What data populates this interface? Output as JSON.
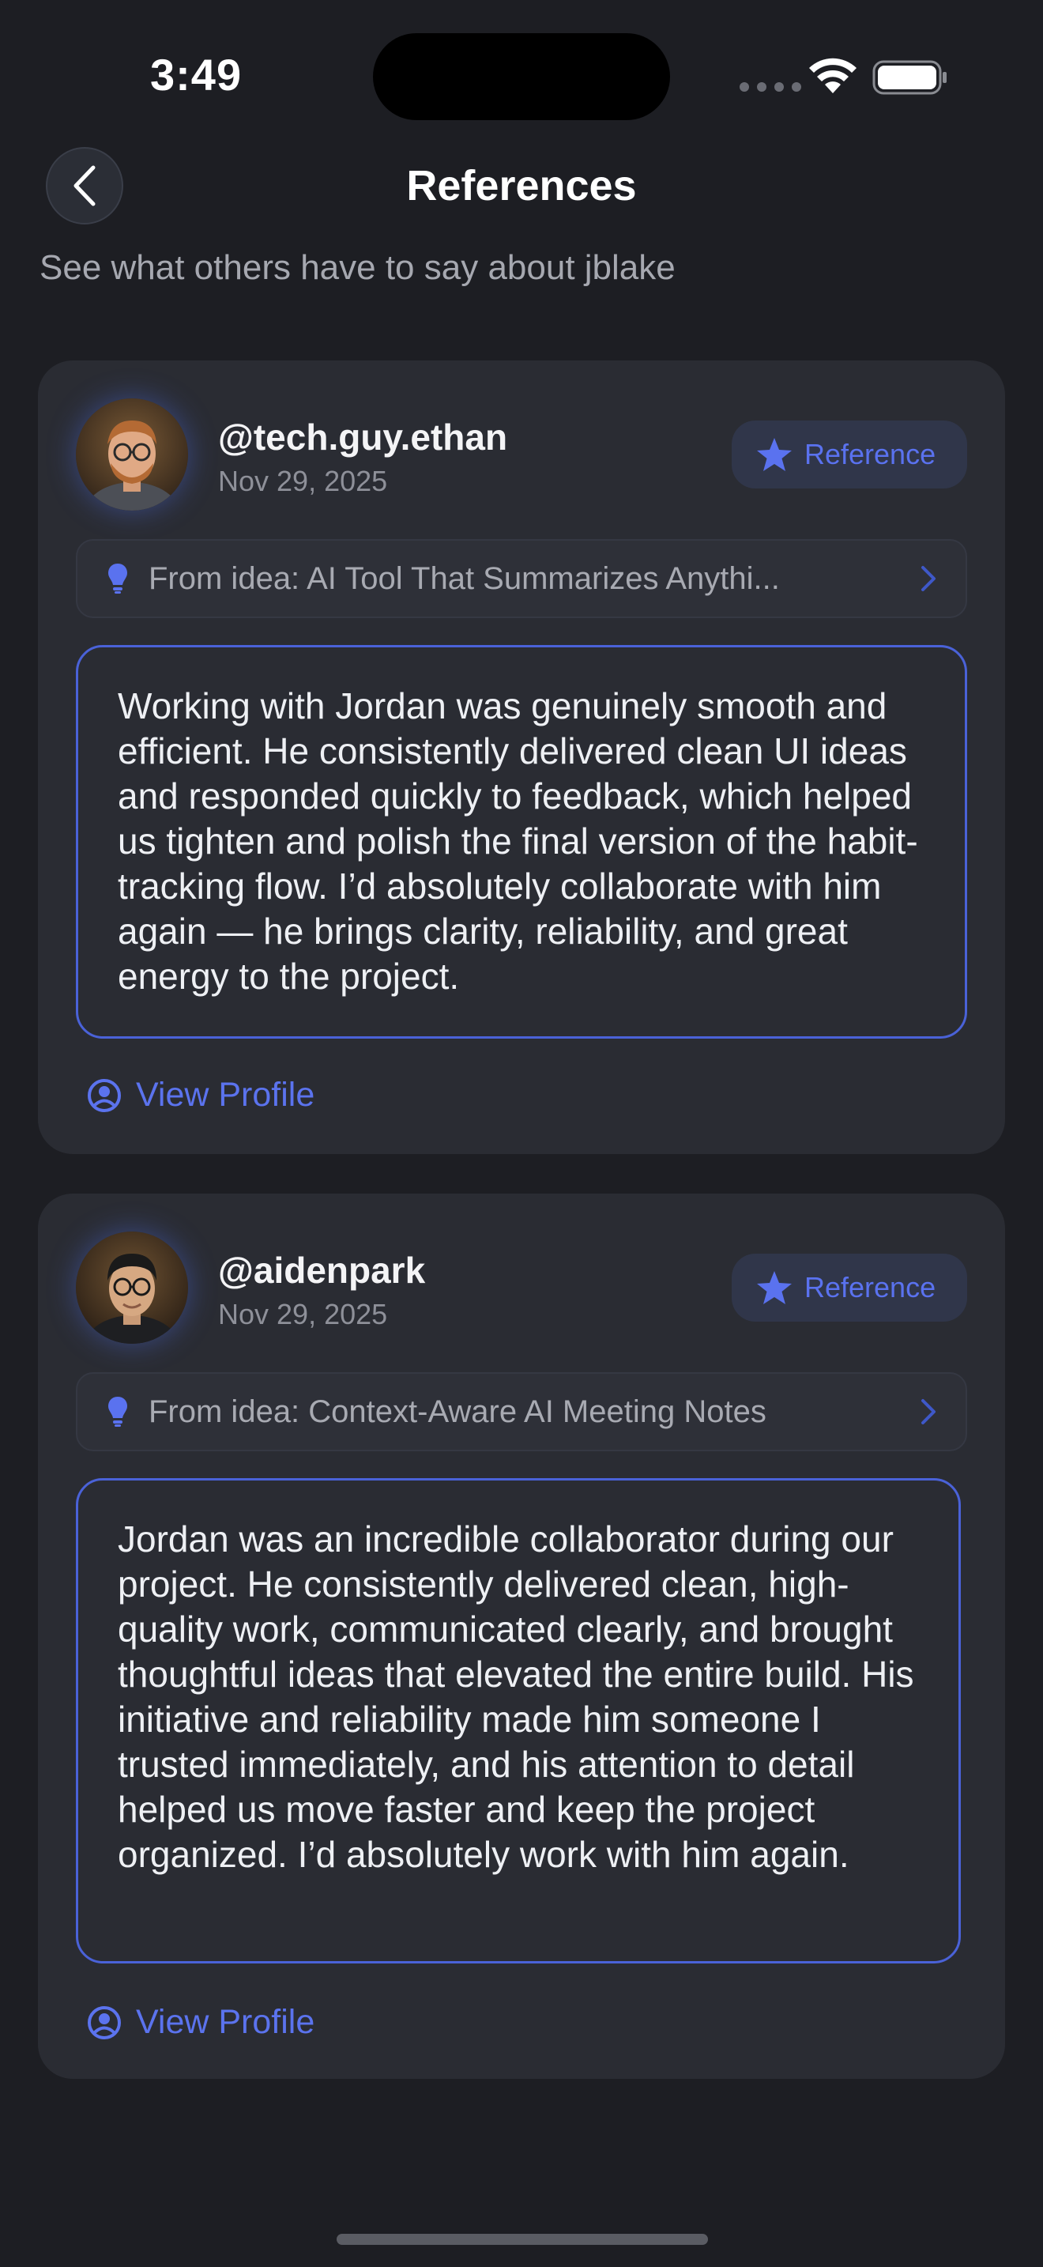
{
  "status_bar": {
    "time": "3:49"
  },
  "nav": {
    "title": "References",
    "subtitle": "See what others have to say about jblake"
  },
  "references": [
    {
      "username": "@tech.guy.ethan",
      "date": "Nov 29, 2025",
      "badge_label": "Reference",
      "idea_label": "From idea: AI Tool That Summarizes Anythi...",
      "text": "Working with Jordan was genuinely smooth and efficient. He consistently delivered clean UI ideas and responded quickly to feedback, which helped us tighten and polish the final version of the habit-tracking flow. I’d absolutely collaborate with him again — he brings clarity, reliability, and great energy to the project.",
      "view_profile_label": "View Profile"
    },
    {
      "username": "@aidenpark",
      "date": "Nov 29, 2025",
      "badge_label": "Reference",
      "idea_label": "From idea: Context-Aware AI Meeting Notes",
      "text": "Jordan was an incredible collaborator during our project. He consistently delivered clean, high-quality work, communicated clearly, and brought thoughtful ideas that elevated the entire build. His initiative and reliability made him someone I trusted immediately, and his attention to detail helped us move faster and keep the project organized. I’d absolutely work with him again.",
      "view_profile_label": "View Profile"
    }
  ],
  "colors": {
    "accent": "#5a72ef",
    "background": "#1d1e23",
    "card": "#2a2c33"
  }
}
